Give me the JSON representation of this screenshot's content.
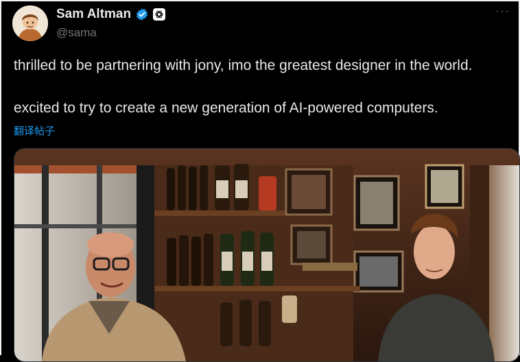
{
  "author": {
    "display_name": "Sam Altman",
    "handle": "@sama",
    "verified_icon": "verified-badge-icon",
    "affiliate_icon": "openai-logo-icon"
  },
  "menu": {
    "more_label": "···"
  },
  "post": {
    "line1": "thrilled to be partnering with jony, imo the greatest designer in the world.",
    "line2": "excited to try to create a new generation of AI-powered computers.",
    "translate_label": "翻译帖子"
  },
  "media": {
    "type": "photo"
  },
  "colors": {
    "background": "#000000",
    "text": "#e7e9ea",
    "muted": "#71767b",
    "link": "#1d9bf0",
    "verified": "#1d9bf0"
  }
}
